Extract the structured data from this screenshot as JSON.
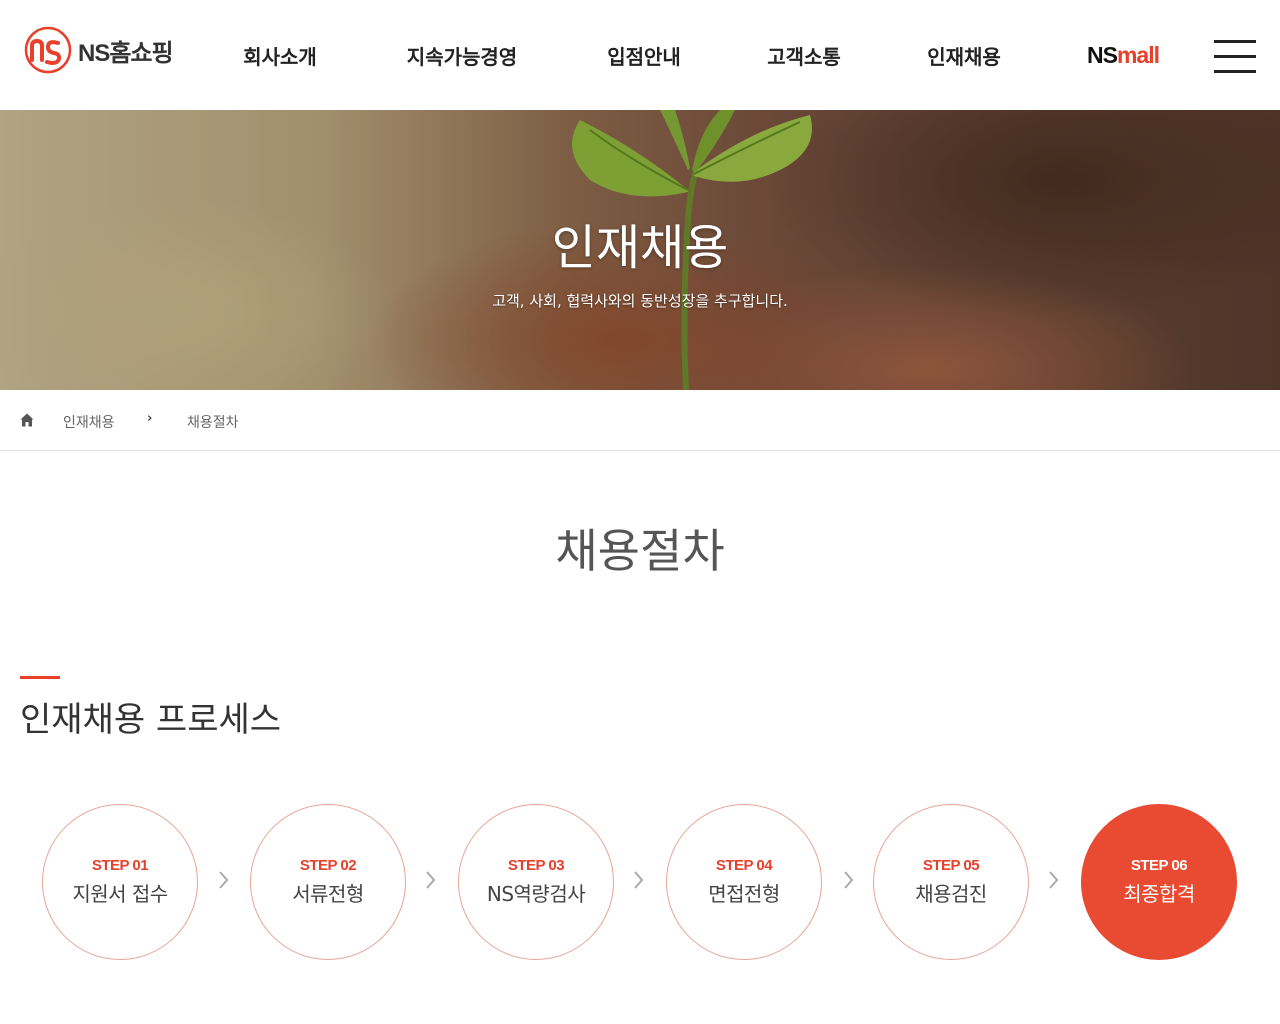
{
  "header": {
    "logo_text": "NS홈쇼핑",
    "nav": [
      "회사소개",
      "지속가능경영",
      "입점안내",
      "고객소통",
      "인재채용"
    ],
    "nsmall_ns": "NS",
    "nsmall_mall": "mall"
  },
  "hero": {
    "title": "인재채용",
    "subtitle": "고객, 사회, 협력사와의 동반성장을 추구합니다."
  },
  "breadcrumb": {
    "level1": "인재채용",
    "level2": "채용절차"
  },
  "main": {
    "page_title": "채용절차",
    "section_title": "인재채용 프로세스",
    "steps": [
      {
        "num": "STEP 01",
        "name": "지원서 접수"
      },
      {
        "num": "STEP 02",
        "name": "서류전형"
      },
      {
        "num": "STEP 03",
        "name": "NS역량검사"
      },
      {
        "num": "STEP 04",
        "name": "면접전형"
      },
      {
        "num": "STEP 05",
        "name": "채용검진"
      },
      {
        "num": "STEP 06",
        "name": "최종합격"
      }
    ]
  },
  "colors": {
    "accent": "#e8402b",
    "step_border": "#e8a495",
    "active_step": "#e94a32"
  },
  "icons": [
    "logo-mark",
    "hamburger-icon",
    "home-icon",
    "chevron-right-icon"
  ]
}
